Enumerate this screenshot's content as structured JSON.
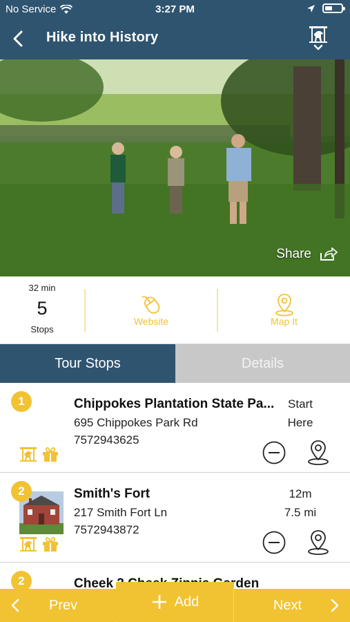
{
  "status_bar": {
    "carrier": "No Service",
    "time": "3:27 PM"
  },
  "nav": {
    "title": "Hike into History"
  },
  "hero": {
    "share_label": "Share"
  },
  "info": {
    "duration": "32 min",
    "stop_count": "5",
    "stops_label": "Stops",
    "website_label": "Website",
    "mapit_label": "Map It"
  },
  "tabs": [
    {
      "label": "Tour Stops",
      "active": true
    },
    {
      "label": "Details",
      "active": false
    }
  ],
  "stops": [
    {
      "badge": "1",
      "name": "Chippokes Plantation State Pa...",
      "address": "695 Chippokes Park Rd",
      "phone": "7572943625",
      "right_top": "Start",
      "right_bottom": "Here"
    },
    {
      "badge": "2",
      "name": "Smith's Fort",
      "address": "217 Smith Fort Ln",
      "phone": "7572943872",
      "right_top": "12m",
      "right_bottom": "7.5 mi"
    },
    {
      "badge": "2",
      "name": "Cheek 2 Cheek Zinnia Garden",
      "address": "",
      "phone": "",
      "right_top": "",
      "right_bottom": ""
    }
  ],
  "bottom_bar": {
    "prev_label": "Prev",
    "add_label": "Add",
    "next_label": "Next"
  },
  "colors": {
    "navy": "#2f5470",
    "accent": "#f1c232",
    "tab_inactive": "#c8c8c8"
  }
}
